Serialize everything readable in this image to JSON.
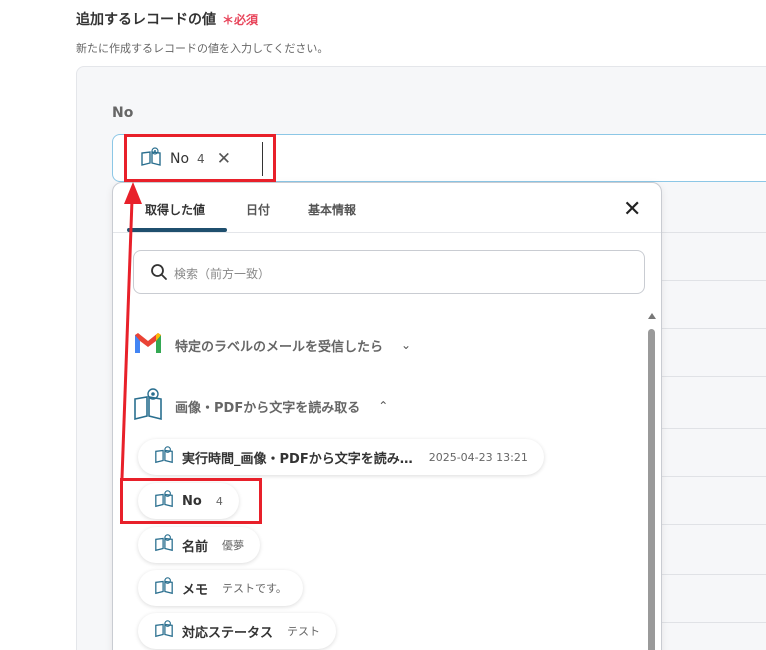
{
  "section": {
    "title": "追加するレコードの値",
    "required_mark": "＊",
    "required_label": "必須",
    "description": "新たに作成するレコードの値を入力してください。"
  },
  "field": {
    "label": "No",
    "chip": {
      "name": "No",
      "value": "4"
    }
  },
  "dropdown": {
    "tabs": [
      {
        "label": "取得した値",
        "active": true
      },
      {
        "label": "日付",
        "active": false
      },
      {
        "label": "基本情報",
        "active": false
      }
    ],
    "search_placeholder": "検索（前方一致）",
    "groups": [
      {
        "label": "特定のラベルのメールを受信したら",
        "icon": "gmail-icon",
        "expanded": false
      },
      {
        "label": "画像・PDFから文字を読み取る",
        "icon": "ocr-book-icon",
        "expanded": true
      }
    ],
    "items": [
      {
        "name": "実行時間_画像・PDFから文字を読み…",
        "value": "2025-04-23 13:21"
      },
      {
        "name": "No",
        "value": "4"
      },
      {
        "name": "名前",
        "value": "優夢"
      },
      {
        "name": "メモ",
        "value": "テストです。"
      },
      {
        "name": "対応ステータス",
        "value": "テスト"
      }
    ]
  },
  "colors": {
    "accent": "#1f4f6e",
    "required": "#e8455b",
    "highlight": "#e8202a",
    "input_border": "#8cc7e6"
  }
}
